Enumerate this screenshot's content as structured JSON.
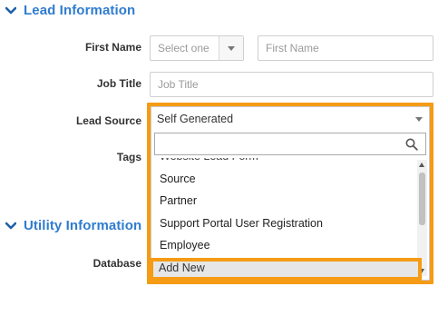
{
  "sections": {
    "lead_info": {
      "title": "Lead Information",
      "icon": "chevron-down-icon"
    },
    "utility_info": {
      "title": "Utility Information",
      "icon": "chevron-down-icon"
    }
  },
  "fields": {
    "first_name": {
      "label": "First Name",
      "salutation_placeholder": "Select one",
      "name_placeholder": "First Name"
    },
    "job_title": {
      "label": "Job Title",
      "placeholder": "Job Title"
    },
    "lead_source": {
      "label": "Lead Source",
      "selected": "Self Generated"
    },
    "tags": {
      "label": "Tags"
    },
    "database": {
      "label": "Database"
    }
  },
  "dropdown": {
    "search_placeholder": "",
    "items": [
      {
        "label": "Website Lead Form",
        "partial": true
      },
      {
        "label": "Source"
      },
      {
        "label": "Partner"
      },
      {
        "label": "Support Portal User Registration"
      },
      {
        "label": "Employee"
      }
    ],
    "add_new_label": "Add New",
    "highlight_color": "#f59b14"
  },
  "colors": {
    "section_title": "#2f7ccf",
    "highlight": "#f59b14"
  }
}
